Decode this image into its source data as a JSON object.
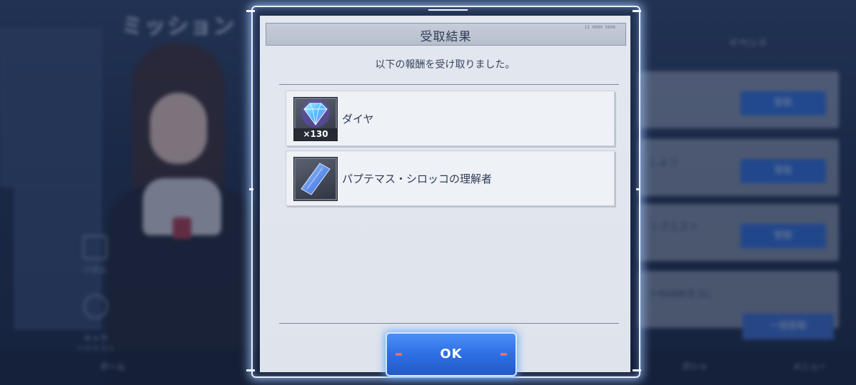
{
  "background": {
    "screen_title": "ミッション",
    "sidebar": [
      {
        "label": "パネル"
      },
      {
        "label": "キャラ\nリクエスト"
      }
    ],
    "event_tab": "イベント",
    "rows": [
      {
        "text": "",
        "button": "受取"
      },
      {
        "text": "しよう",
        "button": "受取"
      },
      {
        "text": "リクエスト",
        "button": "受取"
      },
      {
        "text": "トRANKを3に",
        "button": ""
      }
    ],
    "bulk_button": "一括受取",
    "bottom_nav": {
      "home": "ホーム",
      "gacha": "ガシャ",
      "menu": "メニュー"
    }
  },
  "dialog": {
    "title": "受取結果",
    "code": "12 0000 5896",
    "message": "以下の報酬を受け取りました。",
    "rewards": [
      {
        "name": "ダイヤ",
        "quantity": "×130",
        "icon": "diamond-icon"
      },
      {
        "name": "パプテマス・シロッコの理解者",
        "quantity": "",
        "icon": "plate-icon"
      }
    ],
    "ok_label": "OK"
  },
  "colors": {
    "ok_button": "#2d6fe3",
    "dialog_bg": "#e3e7ef",
    "title_text": "#2f3b55"
  }
}
